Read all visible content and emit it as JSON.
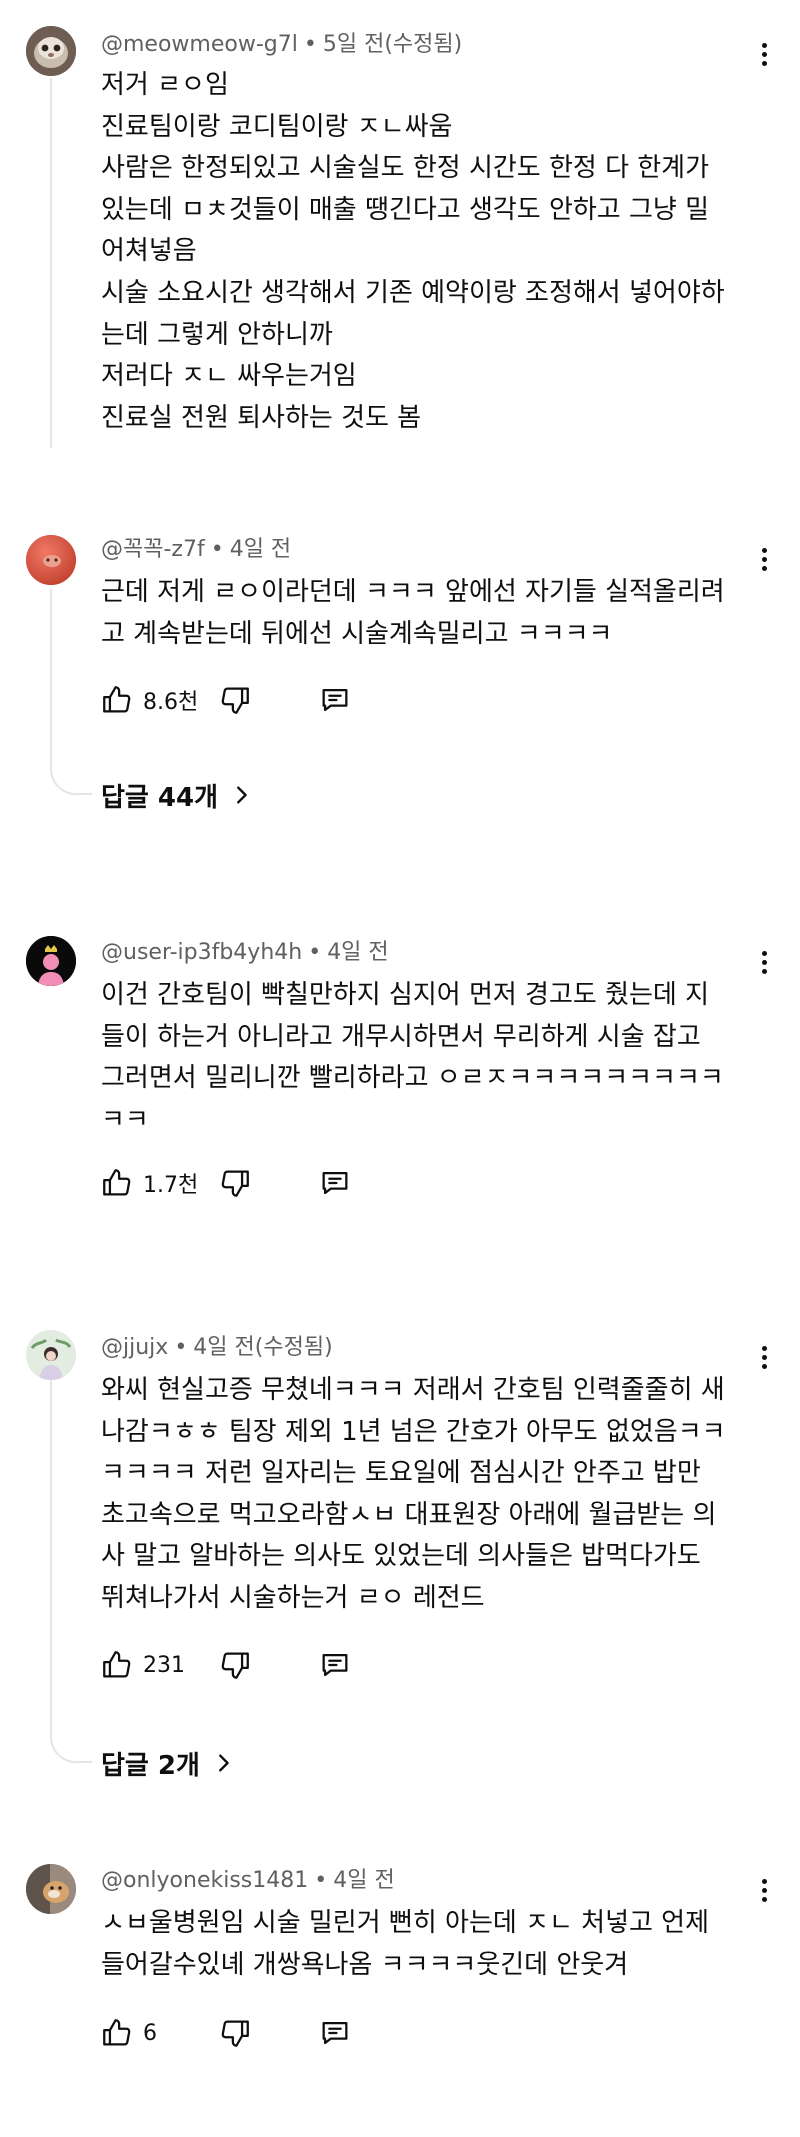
{
  "comments": [
    {
      "author": "@meowmeow-g7l",
      "time": "5일 전(수정됨)",
      "lines": [
        "저거 ㄹㅇ임",
        "진료팀이랑 코디팀이랑 ㅈㄴ싸움",
        "사람은 한정되있고 시술실도 한정 시간도 한정 다 한계가",
        "있는데 ㅁㅊ것들이 매출 땡긴다고 생각도 안하고 그냥 밀",
        "어쳐넣음",
        "시술 소요시간 생각해서 기존 예약이랑 조정해서 넣어야하",
        "는데 그렇게 안하니까",
        "저러다 ㅈㄴ 싸우는거임",
        "진료실 전원 퇴사하는 것도 봄"
      ]
    },
    {
      "author": "@꼭꼭-z7f",
      "time": "4일 전",
      "lines": [
        "근데 저게 ㄹㅇ이라던데 ㅋㅋㅋ 앞에선 자기들 실적올리려",
        "고 계속받는데 뒤에선 시술계속밀리고 ㅋㅋㅋㅋ"
      ],
      "likes": "8.6천",
      "replies": "답글 44개"
    },
    {
      "author": "@user-ip3fb4yh4h",
      "time": "4일 전",
      "lines": [
        "이건 간호팀이 빡칠만하지 심지어 먼저 경고도 줬는데 지",
        "들이 하는거 아니라고 개무시하면서 무리하게 시술 잡고",
        "그러면서 밀리니깐 빨리하라고 ㅇㄹㅈㅋㅋㅋㅋㅋㅋㅋㅋㅋ",
        "ㅋㅋ"
      ],
      "likes": "1.7천"
    },
    {
      "author": "@jjujx",
      "time": "4일 전(수정됨)",
      "lines": [
        "와씨 현실고증 무쳤네ㅋㅋㅋ 저래서 간호팀 인력줄줄히 새",
        "나감ㅋㅎㅎ 팀장 제외 1년 넘은 간호가 아무도 없었음ㅋㅋ",
        "ㅋㅋㅋㅋ 저런 일자리는 토요일에 점심시간 안주고 밥만",
        "초고속으로 먹고오라함ㅅㅂ 대표원장 아래에 월급받는 의",
        "사 말고 알바하는 의사도 있었는데 의사들은 밥먹다가도",
        "뛰쳐나가서 시술하는거 ㄹㅇ 레전드"
      ],
      "likes": "231",
      "replies": "답글 2개"
    },
    {
      "author": "@onlyonekiss1481",
      "time": "4일 전",
      "lines": [
        "ㅅㅂ울병원임 시술 밀린거 뻔히 아는데 ㅈㄴ 처넣고 언제",
        "들어갈수있녜 개쌍욕나옴 ㅋㅋㅋㅋ웃긴데 안웃겨"
      ],
      "likes": "6"
    }
  ],
  "icons": {
    "like": "thumbs-up-icon",
    "dislike": "thumbs-down-icon",
    "reply": "reply-comment-icon",
    "more": "more-vertical-icon",
    "chevron": "chevron-right-icon"
  },
  "colors": {
    "text": "#0f0f0f",
    "meta": "#606060",
    "thread": "#e5e5e5"
  }
}
